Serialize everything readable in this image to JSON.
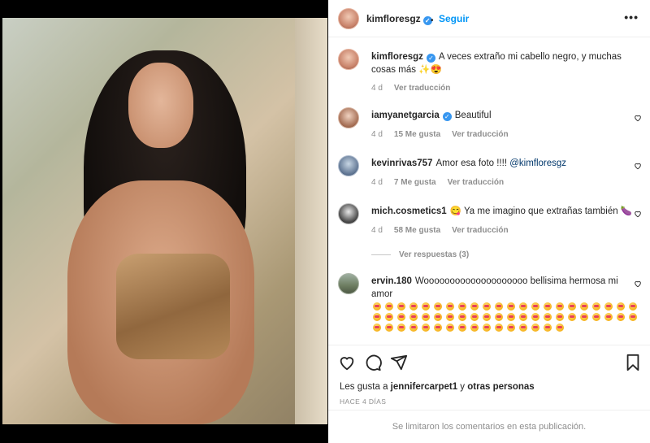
{
  "post": {
    "author": "kimfloresgz",
    "follow_label": "Seguir",
    "more_label": "•••",
    "separator": "•"
  },
  "caption": {
    "username": "kimfloresgz",
    "text": "A veces extraño mi cabello negro, y muchas cosas más ✨😍",
    "time": "4 d",
    "translate": "Ver traducción"
  },
  "comments": [
    {
      "username": "iamyanetgarcia",
      "verified": true,
      "text": "Beautiful",
      "time": "4 d",
      "likes": "15 Me gusta",
      "translate": "Ver traducción"
    },
    {
      "username": "kevinrivas757",
      "verified": false,
      "text": "Amor esa foto !!!! ",
      "mention": "@kimfloresgz",
      "time": "4 d",
      "likes": "7 Me gusta",
      "translate": "Ver traducción"
    },
    {
      "username": "mich.cosmetics1",
      "verified": false,
      "text": "😋 Ya me imagino que extrañas también 🍆",
      "time": "4 d",
      "likes": "58 Me gusta",
      "translate": "Ver traducción",
      "replies": "Ver respuestas (3)"
    },
    {
      "username": "ervin.180",
      "verified": false,
      "text": "Woooooooooooooooooooo bellisima hermosa mi amor"
    }
  ],
  "likes_line": {
    "prefix": "Les gusta a ",
    "user": "jennifercarpet1",
    "middle": " y ",
    "others": "otras personas"
  },
  "timestamp": "HACE 4 DÍAS",
  "footer": "Se limitaron los comentarios en esta publicación.",
  "icons": [
    "heart-icon",
    "comment-icon",
    "share-icon",
    "bookmark-icon",
    "more-options-icon",
    "verified-icon"
  ],
  "colors": {
    "accent": "#0095f6",
    "verified": "#3897f0",
    "muted": "#8e8e8e"
  }
}
